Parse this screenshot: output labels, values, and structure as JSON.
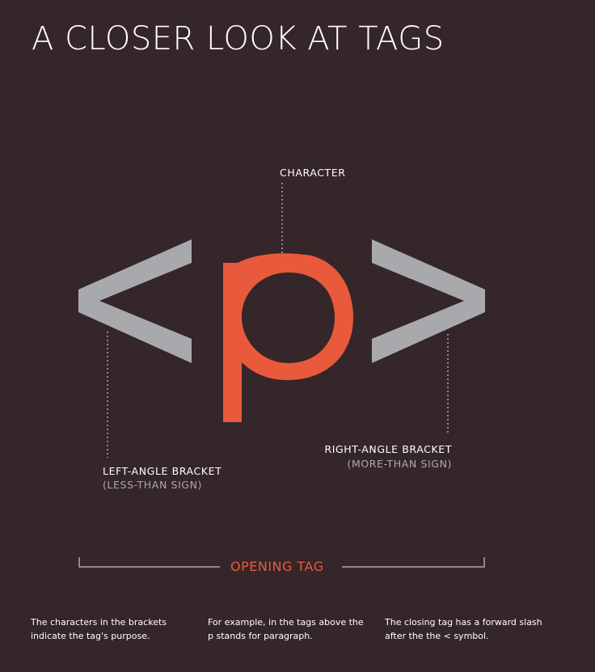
{
  "title": "A CLOSER LOOK AT TAGS",
  "glyphs": {
    "character": "p"
  },
  "labels": {
    "character": "CHARACTER",
    "left_bracket": "LEFT-ANGLE BRACKET",
    "left_bracket_sub": "(LESS-THAN SIGN)",
    "right_bracket": "RIGHT-ANGLE BRACKET",
    "right_bracket_sub": "(MORE-THAN SIGN)",
    "opening_tag": "OPENING TAG"
  },
  "descriptions": [
    "The characters in the brackets indicate the tag's purpose.",
    "For example, in the tags above the p stands for paragraph.",
    "The closing tag has a forward slash after the the < symbol."
  ],
  "colors": {
    "background": "#352629",
    "bracket": "#a8a9ad",
    "character": "#e85a3b",
    "text": "#ffffff",
    "leader": "#8a8b8f"
  }
}
